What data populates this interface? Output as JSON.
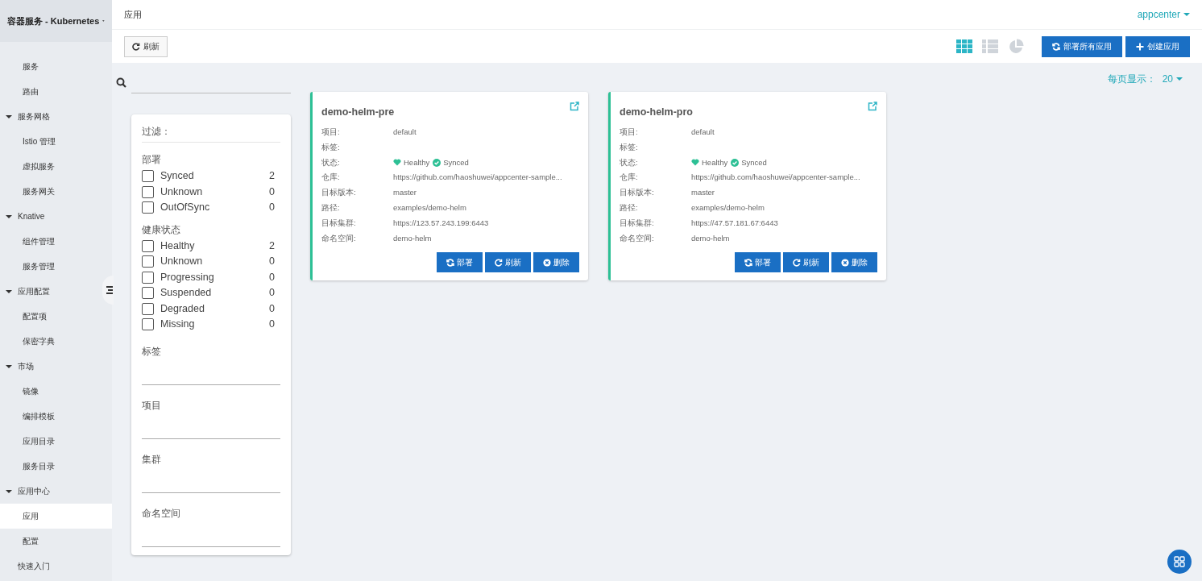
{
  "sidebar": {
    "title": "容器服务 - Kubernetes",
    "items": [
      {
        "kind": "item",
        "label": "服务",
        "selected": false
      },
      {
        "kind": "item",
        "label": "路由",
        "selected": false
      },
      {
        "kind": "group",
        "label": "服务网格",
        "expanded": true,
        "children": [
          {
            "kind": "item",
            "label": "Istio 管理",
            "selected": false
          },
          {
            "kind": "item",
            "label": "虚拟服务",
            "selected": false
          },
          {
            "kind": "item",
            "label": "服务网关",
            "selected": false
          }
        ]
      },
      {
        "kind": "group",
        "label": "Knative",
        "expanded": true,
        "children": [
          {
            "kind": "item",
            "label": "组件管理",
            "selected": false
          },
          {
            "kind": "item",
            "label": "服务管理",
            "selected": false
          }
        ]
      },
      {
        "kind": "group",
        "label": "应用配置",
        "expanded": true,
        "children": [
          {
            "kind": "item",
            "label": "配置项",
            "selected": false
          },
          {
            "kind": "item",
            "label": "保密字典",
            "selected": false
          }
        ]
      },
      {
        "kind": "group",
        "label": "市场",
        "expanded": true,
        "children": [
          {
            "kind": "item",
            "label": "镜像",
            "selected": false
          },
          {
            "kind": "item",
            "label": "编排模板",
            "selected": false
          },
          {
            "kind": "item",
            "label": "应用目录",
            "selected": false
          },
          {
            "kind": "item",
            "label": "服务目录",
            "selected": false
          }
        ]
      },
      {
        "kind": "group",
        "label": "应用中心",
        "expanded": true,
        "children": [
          {
            "kind": "item",
            "label": "应用",
            "selected": true
          },
          {
            "kind": "item",
            "label": "配置",
            "selected": false
          }
        ]
      },
      {
        "kind": "link",
        "label": "快速入门",
        "selected": false
      }
    ]
  },
  "header": {
    "title": "应用",
    "user": "appcenter"
  },
  "toolbar": {
    "refresh": "刷新",
    "view_modes": [
      {
        "kind": "grid",
        "selected": true
      },
      {
        "kind": "list",
        "selected": false
      },
      {
        "kind": "chart",
        "selected": false
      }
    ],
    "buttons": [
      {
        "kind": "sync",
        "label": "部署所有应用"
      },
      {
        "kind": "add",
        "label": "创建应用"
      }
    ]
  },
  "page_size": {
    "label": "每页显示：",
    "value": "20"
  },
  "filters": {
    "title": "过滤：",
    "groups": [
      {
        "title": "部署",
        "options": [
          {
            "label": "Synced",
            "count": "2",
            "checked": false
          },
          {
            "label": "Unknown",
            "count": "0",
            "checked": false
          },
          {
            "label": "OutOfSync",
            "count": "0",
            "checked": false
          }
        ]
      },
      {
        "title": "健康状态",
        "options": [
          {
            "label": "Healthy",
            "count": "2",
            "checked": false
          },
          {
            "label": "Unknown",
            "count": "0",
            "checked": false
          },
          {
            "label": "Progressing",
            "count": "0",
            "checked": false
          },
          {
            "label": "Suspended",
            "count": "0",
            "checked": false
          },
          {
            "label": "Degraded",
            "count": "0",
            "checked": false
          },
          {
            "label": "Missing",
            "count": "0",
            "checked": false
          }
        ]
      }
    ],
    "fields": [
      "标签",
      "项目",
      "集群",
      "命名空间"
    ]
  },
  "apps": [
    {
      "name": "demo-helm-pre",
      "fields": [
        {
          "kind": "text",
          "label": "项目:",
          "value": "default"
        },
        {
          "kind": "text",
          "label": "标签:"
        },
        {
          "kind": "status",
          "label": "状态:",
          "health": "Healthy",
          "sync": "Synced"
        },
        {
          "kind": "text",
          "label": "仓库:",
          "value": "https://github.com/haoshuwei/appcenter-sample..."
        },
        {
          "kind": "text",
          "label": "目标版本:",
          "value": "master"
        },
        {
          "kind": "text",
          "label": "路径:",
          "value": "examples/demo-helm"
        },
        {
          "kind": "text",
          "label": "目标集群:",
          "value": "https://123.57.243.199:6443"
        },
        {
          "kind": "text",
          "label": "命名空间:",
          "value": "demo-helm"
        }
      ],
      "actions": [
        {
          "kind": "sync",
          "label": "部署"
        },
        {
          "kind": "refresh",
          "label": "刷新"
        },
        {
          "kind": "delete",
          "label": "删除"
        }
      ]
    },
    {
      "name": "demo-helm-pro",
      "fields": [
        {
          "kind": "text",
          "label": "项目:",
          "value": "default"
        },
        {
          "kind": "text",
          "label": "标签:"
        },
        {
          "kind": "status",
          "label": "状态:",
          "health": "Healthy",
          "sync": "Synced"
        },
        {
          "kind": "text",
          "label": "仓库:",
          "value": "https://github.com/haoshuwei/appcenter-sample..."
        },
        {
          "kind": "text",
          "label": "目标版本:",
          "value": "master"
        },
        {
          "kind": "text",
          "label": "路径:",
          "value": "examples/demo-helm"
        },
        {
          "kind": "text",
          "label": "目标集群:",
          "value": "https://47.57.181.67:6443"
        },
        {
          "kind": "text",
          "label": "命名空间:",
          "value": "demo-helm"
        }
      ],
      "actions": [
        {
          "kind": "sync",
          "label": "部署"
        },
        {
          "kind": "refresh",
          "label": "刷新"
        },
        {
          "kind": "delete",
          "label": "删除"
        }
      ]
    }
  ]
}
